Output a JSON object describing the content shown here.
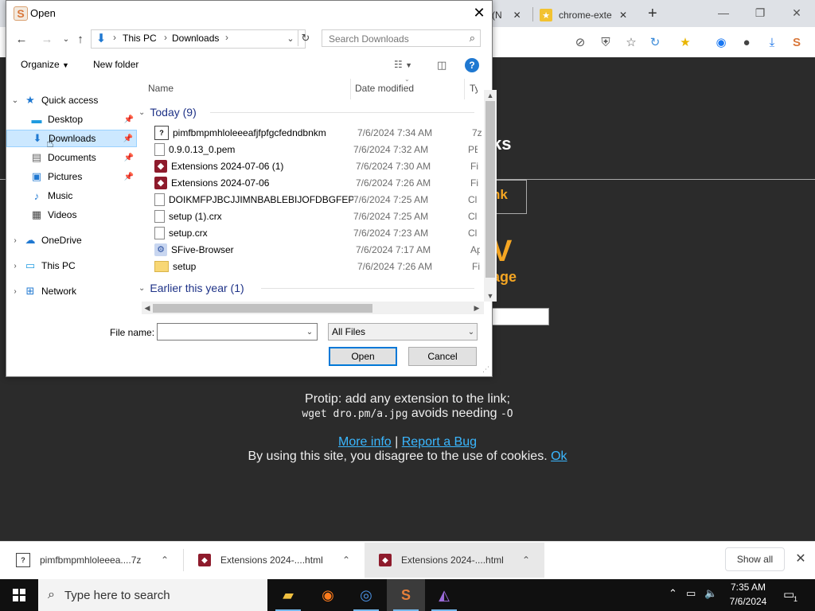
{
  "browser": {
    "tabs": [
      {
        "label": "(N"
      },
      {
        "label": "chrome-exte"
      }
    ],
    "new_tab": "+",
    "window_controls": {
      "minimize": "—",
      "restore": "❐",
      "close": "✕"
    }
  },
  "webpage": {
    "heading_fragment": "ks",
    "link_fragment": "nk",
    "big_letter": "V",
    "sub_fragment": "age",
    "protip_line1": "Protip: add any extension to the link;",
    "protip_code1": "wget dro.pm/a.jpg",
    "protip_mid": " avoids needing ",
    "protip_code2": "-O",
    "more_info": "More info",
    "separator": " | ",
    "report_bug": "Report a Bug",
    "cookie_text": "By using this site, you disagree to the use of cookies.",
    "cookie_ok": "Ok"
  },
  "dialog": {
    "title": "Open",
    "address": {
      "crumbs": [
        "This PC",
        "Downloads"
      ]
    },
    "search_placeholder": "Search Downloads",
    "organize": "Organize",
    "new_folder": "New folder",
    "help": "?",
    "nav_pane": [
      {
        "label": "Quick access",
        "icon": "star-icon",
        "color": "#1f78d1"
      },
      {
        "label": "Desktop",
        "icon": "desktop-icon",
        "color": "#1f9be0"
      },
      {
        "label": "Downloads",
        "icon": "download-arrow-icon",
        "color": "#1f78d1"
      },
      {
        "label": "Documents",
        "icon": "document-icon",
        "color": "#666666"
      },
      {
        "label": "Pictures",
        "icon": "pictures-icon",
        "color": "#1f78d1"
      },
      {
        "label": "Music",
        "icon": "music-note-icon",
        "color": "#1f78d1"
      },
      {
        "label": "Videos",
        "icon": "film-icon",
        "color": "#444444"
      },
      {
        "label": "OneDrive",
        "icon": "cloud-icon",
        "color": "#1f78d1"
      },
      {
        "label": "This PC",
        "icon": "computer-icon",
        "color": "#1f9be0"
      },
      {
        "label": "Network",
        "icon": "network-icon",
        "color": "#1f78d1"
      }
    ],
    "columns": {
      "name": "Name",
      "date": "Date modified",
      "type": "Ty"
    },
    "group_today": "Today (9)",
    "group_earlier": "Earlier this year (1)",
    "files": [
      {
        "name": "pimfbmpmhloleeeafjfpfgcfedndbnkm",
        "date": "7/6/2024 7:34 AM",
        "type": "7z",
        "icon": "archive-7z-icon"
      },
      {
        "name": "0.9.0.13_0.pem",
        "date": "7/6/2024 7:32 AM",
        "type": "PE",
        "icon": "blank-file-icon"
      },
      {
        "name": "Extensions 2024-07-06 (1)",
        "date": "7/6/2024 7:30 AM",
        "type": "Fi",
        "icon": "html-file-icon"
      },
      {
        "name": "Extensions 2024-07-06",
        "date": "7/6/2024 7:26 AM",
        "type": "Fi",
        "icon": "html-file-icon"
      },
      {
        "name": "DOIKMFPJBCJJIMNBABLEBIJOFDBGFEPB_...",
        "date": "7/6/2024 7:25 AM",
        "type": "Cl",
        "icon": "blank-file-icon"
      },
      {
        "name": "setup (1).crx",
        "date": "7/6/2024 7:25 AM",
        "type": "Cl",
        "icon": "blank-file-icon"
      },
      {
        "name": "setup.crx",
        "date": "7/6/2024 7:23 AM",
        "type": "Cl",
        "icon": "blank-file-icon"
      },
      {
        "name": "SFive-Browser",
        "date": "7/6/2024 7:17 AM",
        "type": "Ap",
        "icon": "application-icon"
      },
      {
        "name": "setup",
        "date": "7/6/2024 7:26 AM",
        "type": "Fi",
        "icon": "folder-icon"
      }
    ],
    "filename_label": "File name:",
    "filename_value": "",
    "filetype": "All Files",
    "open_button": "Open",
    "cancel_button": "Cancel"
  },
  "downloads_bar": {
    "items": [
      {
        "label": "pimfbmpmhloleeea....7z",
        "icon": "archive-7z-icon"
      },
      {
        "label": "Extensions 2024-....html",
        "icon": "html-file-icon"
      },
      {
        "label": "Extensions 2024-....html",
        "icon": "html-file-icon"
      }
    ],
    "show_all": "Show all"
  },
  "taskbar": {
    "search_placeholder": "Type here to search",
    "time": "7:35 AM",
    "date": "7/6/2024",
    "notification_count": "1"
  },
  "colors": {
    "accent": "#0078d7",
    "link": "#3ab7ff",
    "orange": "#f5a623"
  }
}
